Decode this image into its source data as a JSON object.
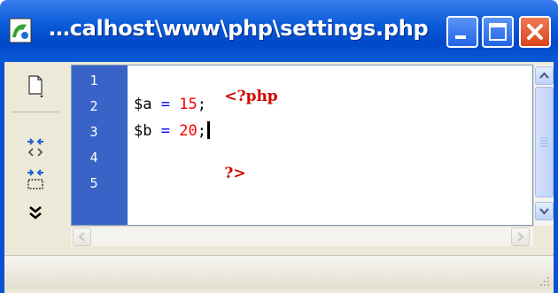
{
  "window": {
    "title": "…calhost\\www\\php\\settings.php",
    "icon": "dreamweaver-file-icon"
  },
  "title_buttons": {
    "minimize": "minimize-icon",
    "maximize": "maximize-icon",
    "close": "close-icon"
  },
  "toolbar": {
    "tools": [
      "document-options-icon",
      "collapse-selection-icon",
      "collapse-full-tag-icon",
      "more-tools-icon"
    ]
  },
  "editor": {
    "line_numbers": [
      "1",
      "2",
      "3",
      "4",
      "5"
    ],
    "code": {
      "line1_tag": "<?php",
      "line2_var": "$a",
      "line2_op": " = ",
      "line2_num": "15",
      "line2_end": ";",
      "line3_var": "$b",
      "line3_op": " = ",
      "line3_num": "20",
      "line3_end": ";",
      "line4_tag": "?>"
    }
  },
  "colors": {
    "titlebar": "#0a5bd9",
    "gutter": "#3a63c8",
    "php_tag": "#d10000",
    "operator": "#0000ff",
    "number": "#ff0000"
  }
}
